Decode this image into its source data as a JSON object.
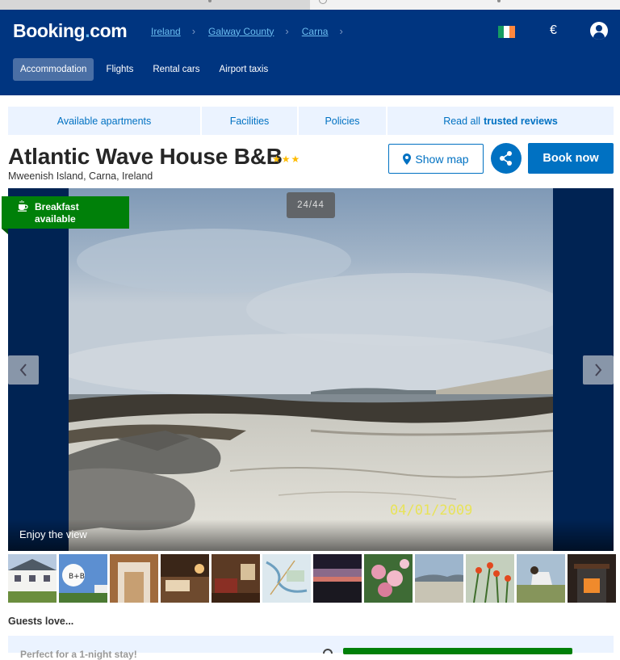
{
  "header": {
    "logo_main": "Booking",
    "logo_dot": ".",
    "logo_suffix": "com",
    "breadcrumb": [
      "Ireland",
      "Galway County",
      "Carna"
    ],
    "currency": "€"
  },
  "nav": {
    "items": [
      "Accommodation",
      "Flights",
      "Rental cars",
      "Airport taxis"
    ],
    "active": "Accommodation"
  },
  "tabs": {
    "apartments": "Available apartments",
    "facilities": "Facilities",
    "policies": "Policies",
    "reviews_prefix": "Read all",
    "reviews_bold": "trusted reviews"
  },
  "property": {
    "name": "Atlantic Wave House B&B",
    "star_rating": 3,
    "address": "Mweenish Island, Carna, Ireland"
  },
  "actions": {
    "show_map": "Show map",
    "book_now": "Book now"
  },
  "gallery": {
    "counter": "24/44",
    "badge": "Breakfast available",
    "caption": "Enjoy the view",
    "photo_date_stamp": "04/01/2009",
    "thumbnail_count": 12
  },
  "guests_love": "Guests love...",
  "bottom_snippet": "Perfect for a 1-night stay!",
  "colors": {
    "brand_blue": "#003580",
    "link_blue": "#0071c2",
    "breakfast_green": "#008009",
    "star_yellow": "#febb02"
  }
}
